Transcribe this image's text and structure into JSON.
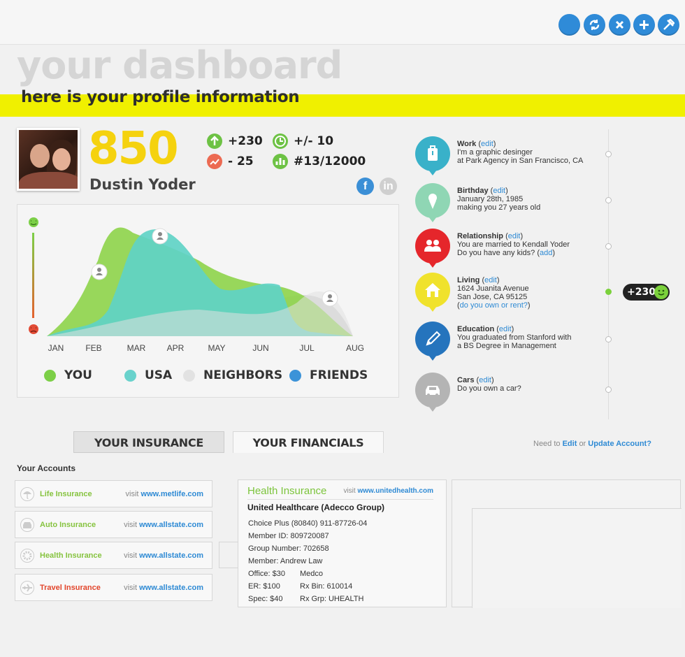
{
  "header": {
    "title": "your dashboard",
    "subtitle": "here is your profile information"
  },
  "toolbar": {
    "icons": [
      "blank-icon",
      "refresh-icon",
      "close-icon",
      "add-icon",
      "tools-icon"
    ]
  },
  "profile": {
    "score": "850",
    "name": "Dustin Yoder",
    "stats": [
      {
        "icon": "arrow-up-icon",
        "value": "+230",
        "color": "#6dc244"
      },
      {
        "icon": "trend-icon",
        "value": "- 25",
        "color": "#ec6a52"
      },
      {
        "icon": "clock-icon",
        "value": "+/- 10",
        "color": "#6dc244"
      },
      {
        "icon": "bar-chart-icon",
        "value": "#13/12000",
        "color": "#6dc244"
      }
    ],
    "social": [
      {
        "icon": "facebook-icon",
        "label": "f"
      },
      {
        "icon": "linkedin-icon",
        "label": "in"
      }
    ]
  },
  "chart_data": {
    "type": "area",
    "categories": [
      "JAN",
      "FEB",
      "MAR",
      "APR",
      "MAY",
      "JUN",
      "JUL",
      "AUG"
    ],
    "series": [
      {
        "name": "YOU",
        "color": "#8ed44a"
      },
      {
        "name": "USA",
        "color": "#5fd3c6"
      },
      {
        "name": "NEIGHBORS",
        "color": "#dcdcdc"
      },
      {
        "name": "FRIENDS",
        "color": "#3b93d8"
      }
    ]
  },
  "legend": [
    {
      "label": "YOU",
      "color": "#7ccf47"
    },
    {
      "label": "USA",
      "color": "#69d2cc"
    },
    {
      "label": "NEIGHBORS",
      "color": "#e2e2e2"
    },
    {
      "label": "FRIENDS",
      "color": "#3c93d8"
    }
  ],
  "timeline": [
    {
      "title": "Work",
      "edit": "edit",
      "lines": [
        "I'm a graphic desinger",
        "at Park Agency in San Francisco, CA"
      ],
      "icon": "briefcase-icon",
      "color": "#39b1c9"
    },
    {
      "title": "Birthday",
      "edit": "edit",
      "lines": [
        "January 28th, 1985",
        "making you 27 years old"
      ],
      "icon": "ice-cream-icon",
      "color": "#8fd6b4"
    },
    {
      "title": "Relationship",
      "edit": "edit",
      "lines": [
        "You are married to Kendall Yoder",
        "Do you have any kids?"
      ],
      "extra_link": "add",
      "icon": "couple-icon",
      "color": "#e5262b"
    },
    {
      "title": "Living",
      "edit": "edit",
      "lines": [
        "1624 Juanita Avenue",
        "San Jose, CA 95125"
      ],
      "extra_line": "do you own or rent?",
      "icon": "house-icon",
      "color": "#f0e22c"
    },
    {
      "title": "Education",
      "edit": "edit",
      "lines": [
        "You graduated from Stanford with",
        "a BS Degree in Management"
      ],
      "icon": "pencil-icon",
      "color": "#2574bd"
    },
    {
      "title": "Cars",
      "edit": "edit",
      "lines": [
        "Do you own a car?"
      ],
      "icon": "car-icon",
      "color": "#b4b4b4"
    }
  ],
  "badge": {
    "value": "+230"
  },
  "tabs": [
    {
      "label": "YOUR INSURANCE"
    },
    {
      "label": "YOUR FINANCIALS"
    }
  ],
  "need": {
    "prefix": "Need to",
    "edit": "Edit",
    "or": "or",
    "update": "Update Account?"
  },
  "accounts": {
    "title": "Your Accounts",
    "items": [
      {
        "name": "Life Insurance",
        "visit": "visit",
        "url": "www.metlife.com",
        "color": "#86c33f",
        "icon": "umbrella-icon"
      },
      {
        "name": "Auto Insurance",
        "visit": "visit",
        "url": "www.allstate.com",
        "color": "#86c33f",
        "icon": "car-icon"
      },
      {
        "name": "Health Insurance",
        "visit": "visit",
        "url": "www.allstate.com",
        "color": "#86c33f",
        "icon": "gear-icon"
      },
      {
        "name": "Travel Insurance",
        "visit": "visit",
        "url": "www.allstate.com",
        "color": "#e2462c",
        "icon": "plane-icon"
      }
    ]
  },
  "detail": {
    "title": "Health Insurance",
    "visit": "visit",
    "url": "www.unitedhealth.com",
    "company": "United Healthcare (Adecco Group)",
    "lines": [
      [
        "Choice Plus (80840) 911-87726-04",
        ""
      ],
      [
        "Member ID: 809720087",
        ""
      ],
      [
        "Group Number: 702658",
        ""
      ],
      [
        "Member: Andrew Law",
        ""
      ],
      [
        "Office: $30",
        "Medco"
      ],
      [
        "ER: $100",
        "Rx Bin: 610014"
      ],
      [
        "Spec: $40",
        "Rx Grp: UHEALTH"
      ]
    ]
  }
}
